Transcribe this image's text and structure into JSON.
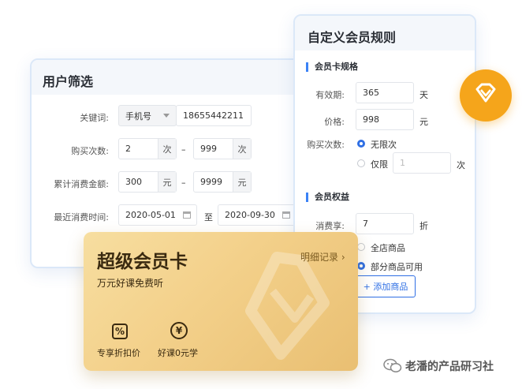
{
  "filter_panel": {
    "title": "用户筛选",
    "keyword_label": "关键词:",
    "keyword_type": "手机号",
    "keyword_value": "18655442211",
    "purchase_count_label": "购买次数:",
    "purchase_min": "2",
    "purchase_max": "999",
    "times_unit": "次",
    "total_spend_label": "累计消费金额:",
    "spend_min": "300",
    "spend_max": "9999",
    "yuan_unit": "元",
    "range_dash": "–",
    "recent_time_label": "最近消费时间:",
    "date_start": "2020-05-01",
    "date_to": "至",
    "date_end": "2020-09-30"
  },
  "rules_panel": {
    "title": "自定义会员规则",
    "card_spec_section": "会员卡规格",
    "validity_label": "有效期:",
    "validity_value": "365",
    "day_unit": "天",
    "price_label": "价格:",
    "price_value": "998",
    "yuan_unit": "元",
    "purchase_times_label": "购买次数:",
    "unlimited_option": "无限次",
    "limited_option": "仅限",
    "limited_placeholder": "1",
    "times_unit": "次",
    "benefits_section": "会员权益",
    "discount_label": "消费享:",
    "discount_value": "7",
    "discount_unit": "折",
    "all_products_option": "全店商品",
    "partial_products_option": "部分商品可用",
    "add_product_button": "+ 添加商品"
  },
  "member_card": {
    "title": "超级会员卡",
    "subtitle": "万元好课免费听",
    "detail_link": "明细记录",
    "detail_chevron": "›",
    "perk1_label": "专享折扣价",
    "perk1_icon": "percent-tag-icon",
    "perk2_label": "好课0元学",
    "perk2_icon": "yuan-coin-icon"
  },
  "badge": {
    "icon": "diamond-icon",
    "color": "#f5a51b"
  },
  "watermark": {
    "text": "老潘的产品研习社",
    "icon": "wechat-icon"
  },
  "colors": {
    "accent": "#2f6fe4",
    "card_gold": "#f3d08a",
    "panel_border": "#dbe8f8"
  }
}
